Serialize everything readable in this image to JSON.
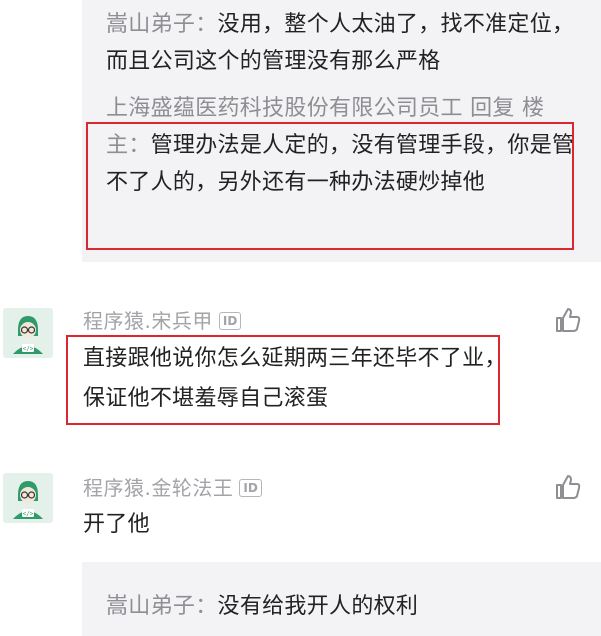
{
  "threads": {
    "top_replies": [
      {
        "author": "嵩山弟子",
        "sep": "：",
        "text": "没用，整个人太油了，找不准定位，而且公司这个的管理没有那么严格"
      },
      {
        "author": "上海盛蕴医药科技股份有限公司员工 回复 楼主",
        "sep": "：",
        "text": "管理办法是人定的，没有管理手段，你是管不了人的，另外还有一种办法硬炒掉他"
      }
    ],
    "comments": [
      {
        "username": "程序猿.宋兵甲",
        "badge": "ID",
        "text": "直接跟他说你怎么延期两三年还毕不了业，保证他不堪羞辱自己滚蛋"
      },
      {
        "username": "程序猿.金轮法王",
        "badge": "ID",
        "text": "开了他"
      }
    ],
    "bottom_reply": {
      "author": "嵩山弟子",
      "sep": "：",
      "text": "没有给我开人的权利"
    }
  },
  "colors": {
    "highlight": "#d9282f",
    "reply_bg": "#f3f3f5",
    "muted": "#8e8e93",
    "avatar_bg": "#e3f1ea",
    "avatar_green": "#2f9a6a"
  },
  "icons": [
    "avatar-coder-icon",
    "thumbs-up-icon",
    "id-badge"
  ]
}
